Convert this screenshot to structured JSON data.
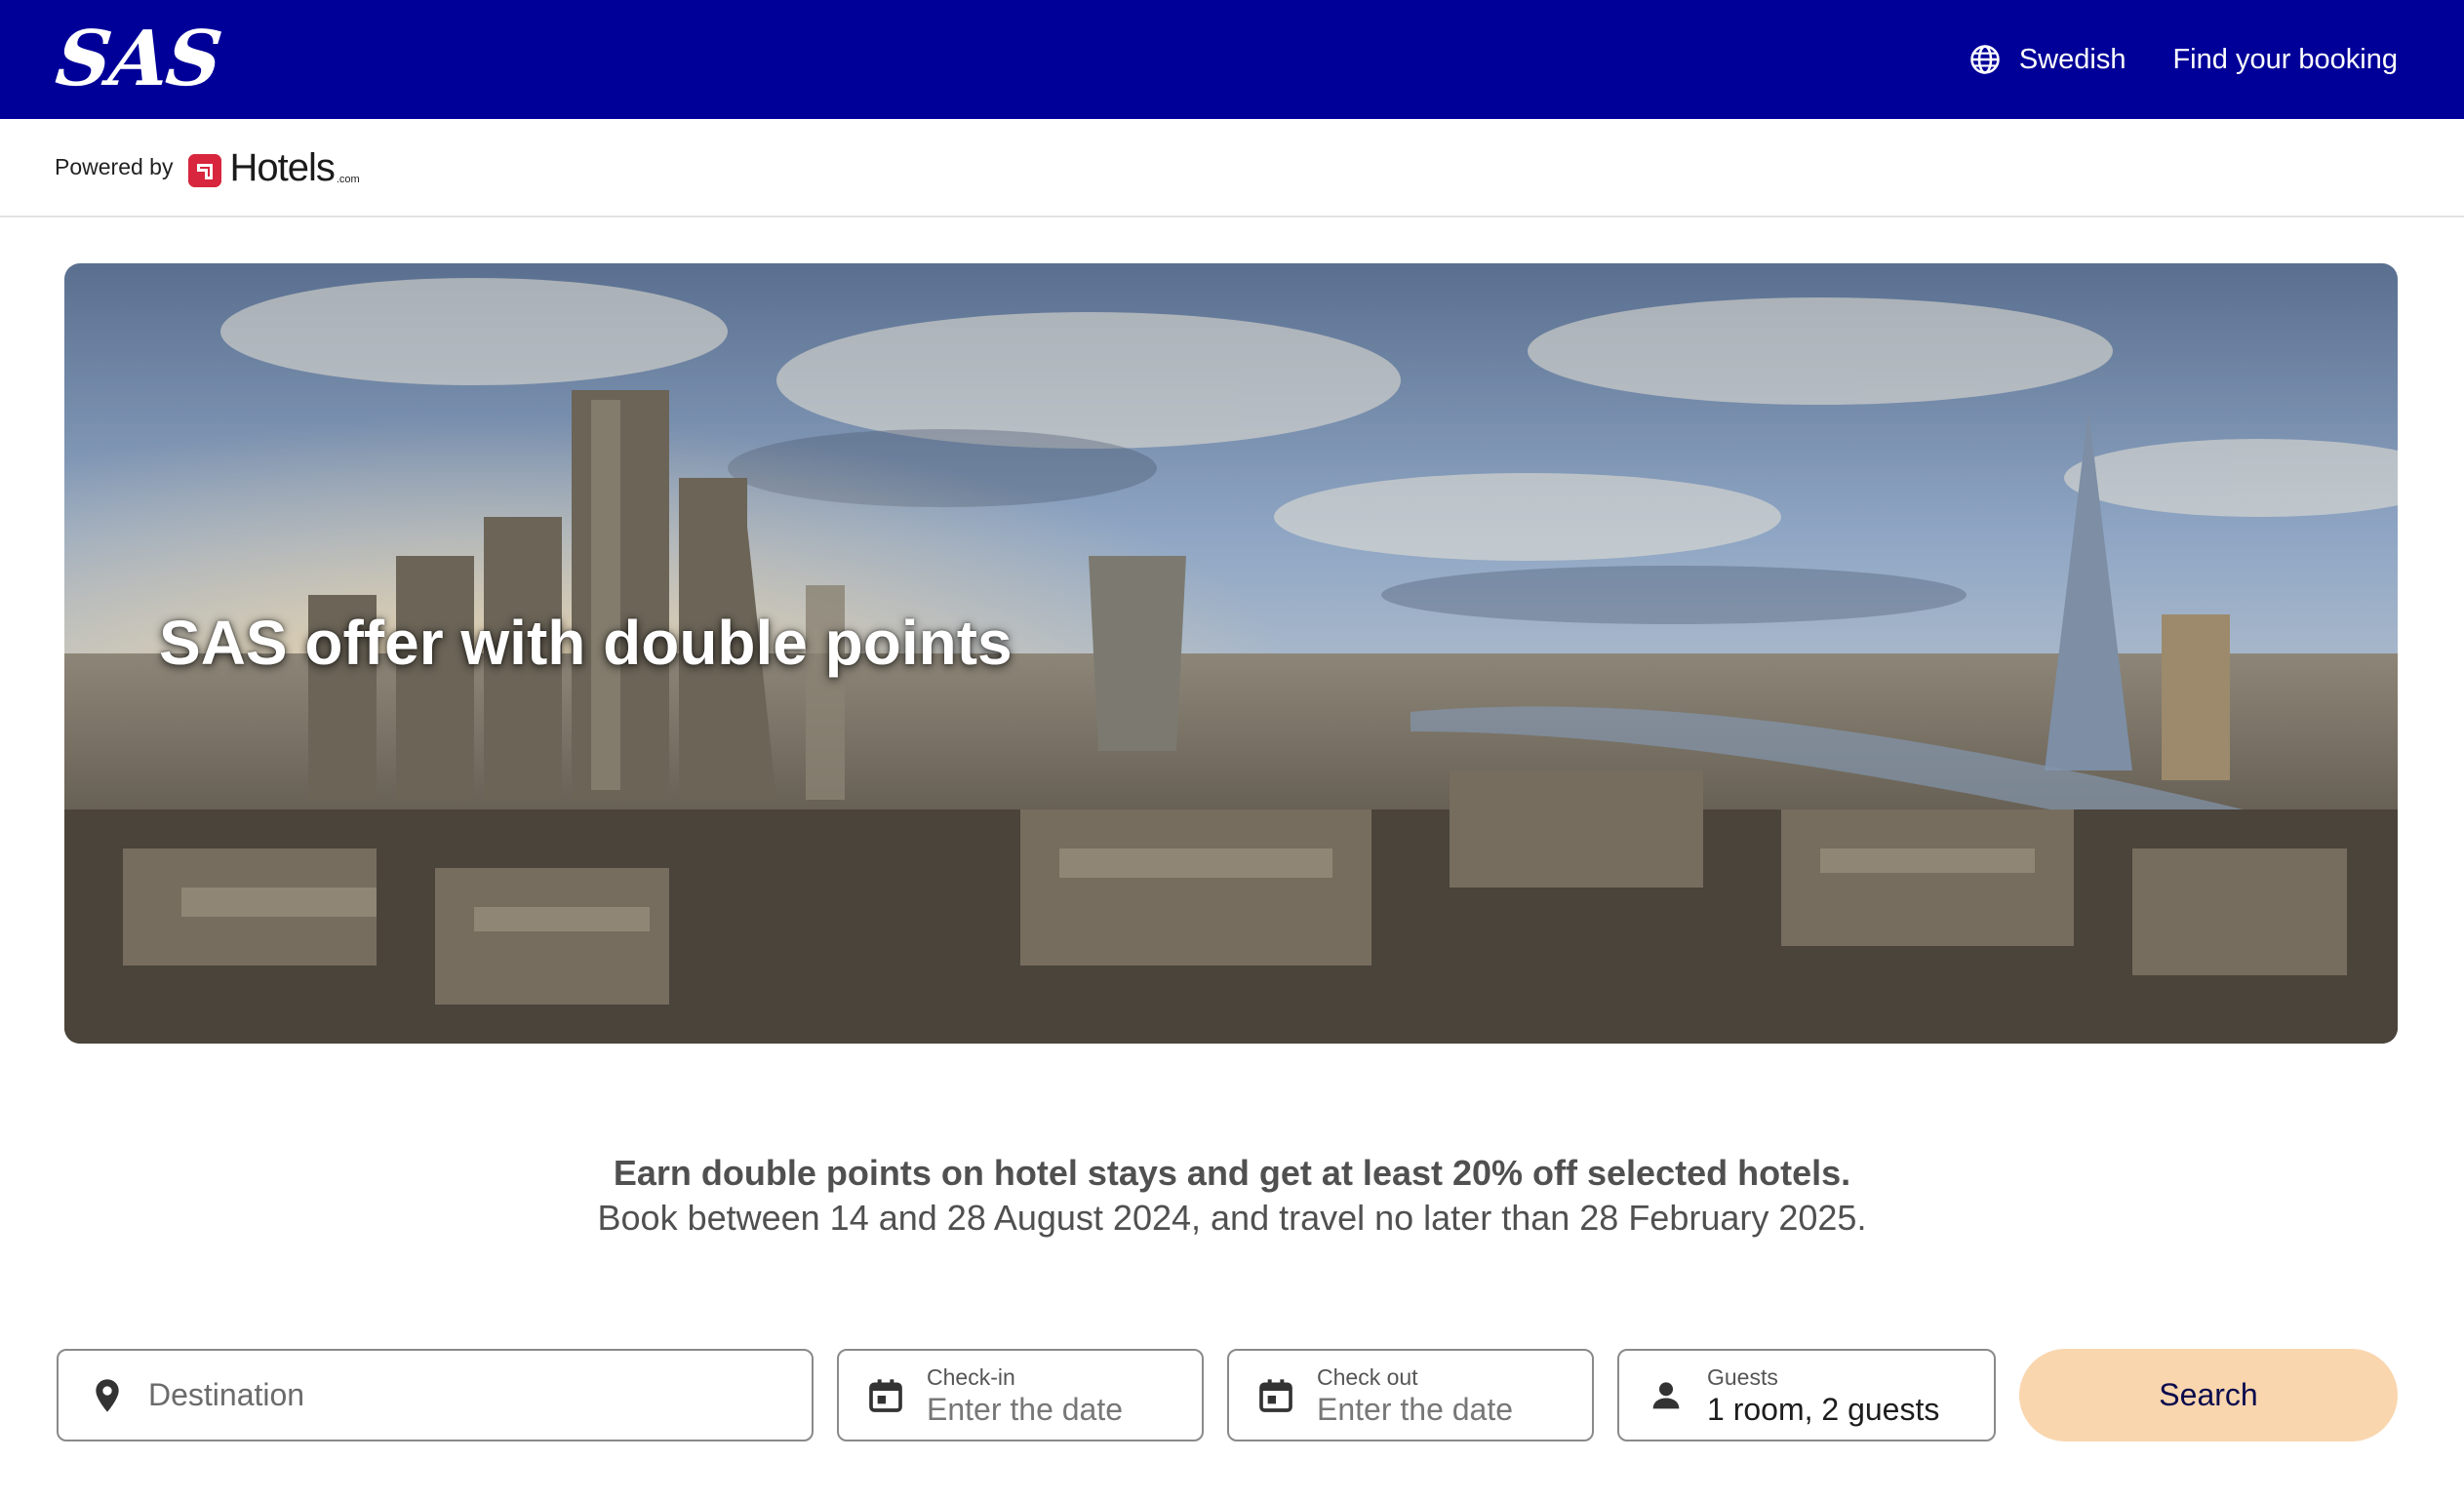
{
  "header": {
    "logo_text": "SAS",
    "language_label": "Swedish",
    "language_icon": "globe-icon",
    "find_booking_label": "Find your booking",
    "brand_color": "#000099"
  },
  "partner": {
    "powered_by_label": "Powered by",
    "brand_name": "Hotels",
    "brand_suffix": ".com",
    "brand_color": "#d32f2f"
  },
  "hero": {
    "title": "SAS offer with double points",
    "image_subject": "city skyline panorama"
  },
  "promo": {
    "headline": "Earn double points on hotel stays and get at least 20% off selected hotels.",
    "subtext": "Book between 14 and 28 August 2024, and travel no later than 28 February 2025."
  },
  "search_form": {
    "destination": {
      "placeholder": "Destination",
      "icon": "location-pin-icon"
    },
    "checkin": {
      "label": "Check-in",
      "value": "Enter the date",
      "icon": "calendar-icon"
    },
    "checkout": {
      "label": "Check out",
      "value": "Enter the date",
      "icon": "calendar-icon"
    },
    "guests": {
      "label": "Guests",
      "value": "1 room, 2 guests",
      "icon": "person-icon"
    },
    "search_label": "Search",
    "search_button_color": "#f9d6ae"
  }
}
